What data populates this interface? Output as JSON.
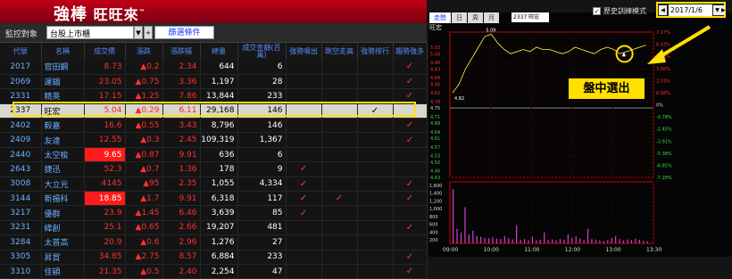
{
  "app": {
    "logo_a": "強棒",
    "logo_b": "旺旺來",
    "tm": "™"
  },
  "controls": {
    "monitor_label": "監控對象",
    "market_value": "台股上市櫃",
    "filter_label": "篩選條件"
  },
  "columns": [
    "代號",
    "名稱",
    "成交價",
    "漲跌",
    "漲跌幅",
    "總量",
    "成交金額(百萬)",
    "強勢噴出",
    "跳空走高",
    "強勢排行",
    "趨勢強多"
  ],
  "rows": [
    {
      "code": "2017",
      "name": "官田鋼",
      "price": "8.73",
      "chg": "▲0.2",
      "pct": "2.34",
      "vol": "644",
      "amt": "6",
      "c1": "",
      "c2": "",
      "c3": "",
      "c4": "✓",
      "price_bg": false
    },
    {
      "code": "2069",
      "name": "運錩",
      "price": "23.05",
      "chg": "▲0.75",
      "pct": "3.36",
      "vol": "1,197",
      "amt": "28",
      "c1": "",
      "c2": "",
      "c3": "",
      "c4": "✓",
      "price_bg": false
    },
    {
      "code": "2331",
      "name": "精英",
      "price": "17.15",
      "chg": "▲1.25",
      "pct": "7.86",
      "vol": "13,844",
      "amt": "233",
      "c1": "",
      "c2": "",
      "c3": "",
      "c4": "✓",
      "price_bg": false
    },
    {
      "code": "2337",
      "name": "旺宏",
      "price": "5.04",
      "chg": "▲0.29",
      "pct": "6.11",
      "vol": "29,168",
      "amt": "146",
      "c1": "",
      "c2": "",
      "c3": "✓",
      "c4": "",
      "price_bg": false
    },
    {
      "code": "2402",
      "name": "毅嘉",
      "price": "16.6",
      "chg": "▲0.55",
      "pct": "3.43",
      "vol": "8,796",
      "amt": "146",
      "c1": "",
      "c2": "",
      "c3": "",
      "c4": "✓",
      "price_bg": false
    },
    {
      "code": "2409",
      "name": "友達",
      "price": "12.55",
      "chg": "▲0.3",
      "pct": "2.45",
      "vol": "109,319",
      "amt": "1,367",
      "c1": "",
      "c2": "",
      "c3": "",
      "c4": "✓",
      "price_bg": false
    },
    {
      "code": "2440",
      "name": "太空梭",
      "price": "9.65",
      "chg": "▲0.87",
      "pct": "9.91",
      "vol": "636",
      "amt": "6",
      "c1": "",
      "c2": "",
      "c3": "",
      "c4": "",
      "price_bg": true
    },
    {
      "code": "2643",
      "name": "捷迅",
      "price": "52.3",
      "chg": "▲0.7",
      "pct": "1.36",
      "vol": "178",
      "amt": "9",
      "c1": "✓",
      "c2": "",
      "c3": "",
      "c4": "",
      "price_bg": false
    },
    {
      "code": "3008",
      "name": "大立光",
      "price": "4145",
      "chg": "▲95",
      "pct": "2.35",
      "vol": "1,055",
      "amt": "4,334",
      "c1": "✓",
      "c2": "",
      "c3": "",
      "c4": "✓",
      "price_bg": false
    },
    {
      "code": "3144",
      "name": "新揚科",
      "price": "18.85",
      "chg": "▲1.7",
      "pct": "9.91",
      "vol": "6,318",
      "amt": "117",
      "c1": "✓",
      "c2": "✓",
      "c3": "",
      "c4": "✓",
      "price_bg": true
    },
    {
      "code": "3217",
      "name": "優群",
      "price": "23.9",
      "chg": "▲1.45",
      "pct": "6.46",
      "vol": "3,639",
      "amt": "85",
      "c1": "✓",
      "c2": "",
      "c3": "",
      "c4": "",
      "price_bg": false
    },
    {
      "code": "3231",
      "name": "緯創",
      "price": "25.1",
      "chg": "▲0.65",
      "pct": "2.66",
      "vol": "19,207",
      "amt": "481",
      "c1": "",
      "c2": "",
      "c3": "",
      "c4": "✓",
      "price_bg": false
    },
    {
      "code": "3284",
      "name": "太普高",
      "price": "20.9",
      "chg": "▲0.6",
      "pct": "2.96",
      "vol": "1,276",
      "amt": "27",
      "c1": "",
      "c2": "",
      "c3": "",
      "c4": "",
      "price_bg": false
    },
    {
      "code": "3305",
      "name": "昇貿",
      "price": "34.85",
      "chg": "▲2.75",
      "pct": "8.57",
      "vol": "6,884",
      "amt": "233",
      "c1": "",
      "c2": "",
      "c3": "",
      "c4": "✓",
      "price_bg": false
    },
    {
      "code": "3310",
      "name": "佳穎",
      "price": "21.35",
      "chg": "▲0.5",
      "pct": "2.40",
      "vol": "2,254",
      "amt": "47",
      "c1": "",
      "c2": "",
      "c3": "",
      "c4": "✓",
      "price_bg": false
    }
  ],
  "chart_panel": {
    "tabs": [
      "走勢",
      "日",
      "周",
      "月"
    ],
    "stock_selector": "2337 旺宏",
    "stock_label": "旺宏",
    "history_mode": "歷史訓練模式",
    "history_checked": "✓",
    "date": "2017/1/6",
    "annotation": "盤中選出"
  },
  "chart_data": {
    "type": "line",
    "title": "",
    "x_ticks": [
      "09:00",
      "10:00",
      "11:00",
      "12:00",
      "13:00",
      "13:30"
    ],
    "y_ticks_left": [
      "5.03",
      "5.00",
      "4.96",
      "4.93",
      "4.89",
      "4.86",
      "4.82",
      "4.78",
      "4.75",
      "4.71",
      "4.68",
      "4.64",
      "4.61",
      "4.57",
      "4.53",
      "4.50",
      "4.46",
      "4.43"
    ],
    "y_ticks_right": [
      "7.17%",
      "6.43%",
      "4.96%",
      "3.50%",
      "2.03%",
      "0.56%",
      "0%",
      "-0.78%",
      "-2.45%",
      "-3.91%",
      "-5.38%",
      "-6.85%",
      "-7.28%"
    ],
    "volume_ticks": [
      "1,600",
      "1,400",
      "1,200",
      "1,000",
      "800",
      "600",
      "400",
      "200"
    ],
    "price_series": [
      4.82,
      4.86,
      4.93,
      4.98,
      5.03,
      5.08,
      5.09,
      5.05,
      5.02,
      5.0,
      5.01,
      5.02,
      5.01,
      5.03,
      5.02,
      5.02,
      5.01,
      5.0,
      5.01,
      5.03,
      5.02,
      5.01,
      5.0,
      5.02,
      5.03,
      5.02,
      5.0,
      5.01,
      5.02,
      5.03,
      5.04
    ],
    "reference": 4.75,
    "high_label": "5.09",
    "low_label": "4.82",
    "volume": [
      1500,
      400,
      300,
      1000,
      250,
      350,
      200,
      180,
      150,
      140,
      160,
      130,
      120,
      200,
      140,
      110,
      500,
      100,
      120,
      90,
      180,
      80,
      100,
      300,
      90,
      110,
      80,
      120,
      100,
      250,
      150,
      200,
      130,
      90,
      400,
      120,
      100,
      80,
      60,
      90,
      150,
      200,
      120,
      80,
      110,
      90,
      130,
      100,
      70,
      60
    ]
  }
}
